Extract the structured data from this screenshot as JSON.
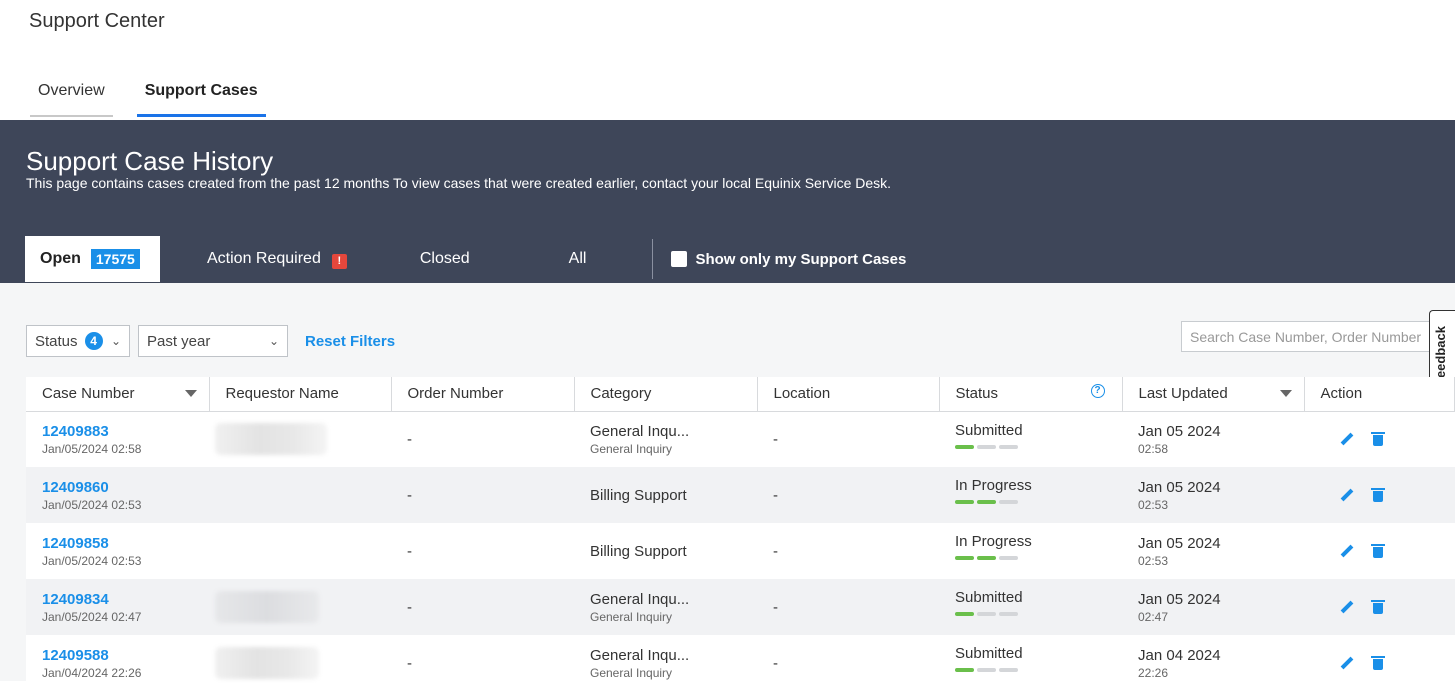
{
  "app_title": "Support Center",
  "main_tabs": [
    "Overview",
    "Support Cases"
  ],
  "banner": {
    "title": "Support Case History",
    "description": "This page contains cases created from the past 12 months To view cases that were created earlier, contact your local Equinix Service Desk."
  },
  "sub_tabs": {
    "open_label": "Open",
    "open_count": "17575",
    "action_required_label": "Action Required",
    "alert_glyph": "!",
    "closed_label": "Closed",
    "all_label": "All",
    "my_cases_label": "Show only my Support Cases"
  },
  "filters": {
    "status_label": "Status",
    "status_count": "4",
    "period_value": "Past year",
    "reset_label": "Reset Filters",
    "search_placeholder": "Search Case Number, Order Number"
  },
  "feedback_label": "Feedback",
  "table": {
    "headers": [
      "Case Number",
      "Requestor Name",
      "Order Number",
      "Category",
      "Location",
      "Status",
      "Last Updated",
      "Action"
    ],
    "rows": [
      {
        "case": "12409883",
        "created": "Jan/05/2024 02:58",
        "order": "-",
        "category": "General Inqu...",
        "subcategory": "General Inquiry",
        "location": "-",
        "status": "Submitted",
        "updated_date": "Jan 05 2024",
        "updated_time": "02:58"
      },
      {
        "case": "12409860",
        "created": "Jan/05/2024 02:53",
        "order": "-",
        "category": "Billing Support",
        "subcategory": "",
        "location": "-",
        "status": "In Progress",
        "updated_date": "Jan 05 2024",
        "updated_time": "02:53"
      },
      {
        "case": "12409858",
        "created": "Jan/05/2024 02:53",
        "order": "-",
        "category": "Billing Support",
        "subcategory": "",
        "location": "-",
        "status": "In Progress",
        "updated_date": "Jan 05 2024",
        "updated_time": "02:53"
      },
      {
        "case": "12409834",
        "created": "Jan/05/2024 02:47",
        "order": "-",
        "category": "General Inqu...",
        "subcategory": "General Inquiry",
        "location": "-",
        "status": "Submitted",
        "updated_date": "Jan 05 2024",
        "updated_time": "02:47"
      },
      {
        "case": "12409588",
        "created": "Jan/04/2024 22:26",
        "order": "-",
        "category": "General Inqu...",
        "subcategory": "General Inquiry",
        "location": "-",
        "status": "Submitted",
        "updated_date": "Jan 04 2024",
        "updated_time": "22:26"
      }
    ]
  },
  "colors": {
    "accent": "#1a8fe8",
    "banner": "#3e4659",
    "progress_done": "#6abf4b",
    "alert": "#e5473c"
  }
}
